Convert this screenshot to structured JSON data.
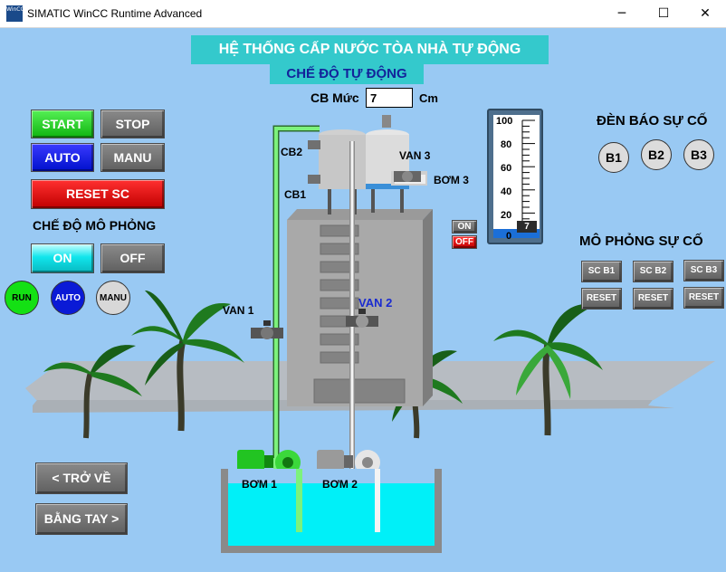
{
  "window": {
    "title": "SIMATIC WinCC Runtime Advanced",
    "icon_text": "WinCC",
    "minimize": "─",
    "maximize": "☐",
    "close": "✕"
  },
  "header": {
    "title": "HỆ THỐNG CẤP NƯỚC TÒA NHÀ TỰ ĐỘNG",
    "mode": "CHẾ ĐỘ TỰ ĐỘNG"
  },
  "level_sensor": {
    "label": "CB Mức",
    "value": "7",
    "unit": "Cm"
  },
  "control": {
    "start": "START",
    "stop": "STOP",
    "auto": "AUTO",
    "manu": "MANU",
    "reset_sc": "RESET SC",
    "sim_mode_title": "CHẾ ĐỘ MÔ PHỎNG",
    "sim_on": "ON",
    "sim_off": "OFF"
  },
  "indicators": {
    "run": "RUN",
    "auto": "AUTO",
    "manu": "MANU",
    "run_color": "#14e014",
    "auto_color": "#0a1ad6",
    "manu_color": "#d8d8d8"
  },
  "gauge": {
    "ticks": [
      "100",
      "80",
      "60",
      "40",
      "20",
      "0"
    ],
    "value": 7,
    "value_text": "7",
    "max": 100
  },
  "tank_switch": {
    "on": "ON",
    "off": "OFF"
  },
  "fault_lights": {
    "title": "ĐÈN BÁO SỰ CỐ",
    "lights": [
      "B1",
      "B2",
      "B3"
    ]
  },
  "fault_sim": {
    "title": "MÔ PHỎNG SỰ CỐ",
    "sc_buttons": [
      "SC B1",
      "SC B2",
      "SC B3"
    ],
    "reset_buttons": [
      "RESET",
      "RESET",
      "RESET"
    ]
  },
  "labels": {
    "cb2": "CB2",
    "cb1": "CB1",
    "van3": "VAN 3",
    "bom3": "BƠM 3",
    "van1": "VAN 1",
    "van2": "VAN 2",
    "bom1": "BƠM 1",
    "bom2": "BƠM 2"
  },
  "nav": {
    "back": "< TRỞ VỀ",
    "manual": "BẰNG TAY >"
  },
  "colors": {
    "background": "#99c9f3",
    "header": "#34c9cc",
    "water": "#00f0f8",
    "pipe_active": "#7cf27c",
    "pipe_idle": "#f4f4f4"
  }
}
